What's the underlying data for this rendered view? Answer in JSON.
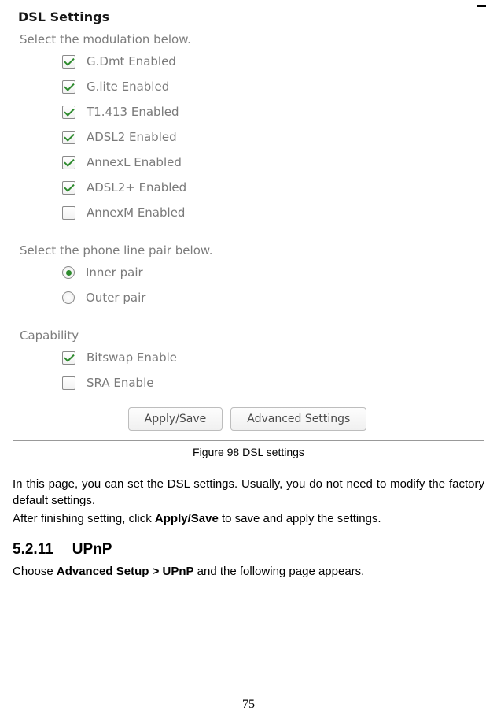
{
  "panel": {
    "title": "DSL Settings",
    "modulation_label": "Select the modulation below.",
    "modulation": [
      {
        "label": "G.Dmt Enabled",
        "checked": true
      },
      {
        "label": "G.lite Enabled",
        "checked": true
      },
      {
        "label": "T1.413 Enabled",
        "checked": true
      },
      {
        "label": "ADSL2 Enabled",
        "checked": true
      },
      {
        "label": "AnnexL Enabled",
        "checked": true
      },
      {
        "label": "ADSL2+ Enabled",
        "checked": true
      },
      {
        "label": "AnnexM Enabled",
        "checked": false
      }
    ],
    "phone_label": "Select the phone line pair below.",
    "phone": [
      {
        "label": "Inner pair",
        "checked": true
      },
      {
        "label": "Outer pair",
        "checked": false
      }
    ],
    "capability_label": "Capability",
    "capability": [
      {
        "label": "Bitswap Enable",
        "checked": true
      },
      {
        "label": "SRA Enable",
        "checked": false
      }
    ],
    "buttons": {
      "apply": "Apply/Save",
      "advanced": "Advanced Settings"
    }
  },
  "figure_caption": "Figure 98 DSL settings",
  "body": {
    "p1": "In this page, you can set the DSL settings. Usually, you do not need to modify the factory default settings.",
    "p2_pre": "After finishing setting, click ",
    "p2_bold": "Apply/Save",
    "p2_post": " to save and apply the settings."
  },
  "heading": {
    "num": "5.2.11",
    "title": "UPnP"
  },
  "sub": {
    "pre": "Choose ",
    "bold": "Advanced Setup > UPnP",
    "post": " and the following page appears."
  },
  "page_number": "75"
}
